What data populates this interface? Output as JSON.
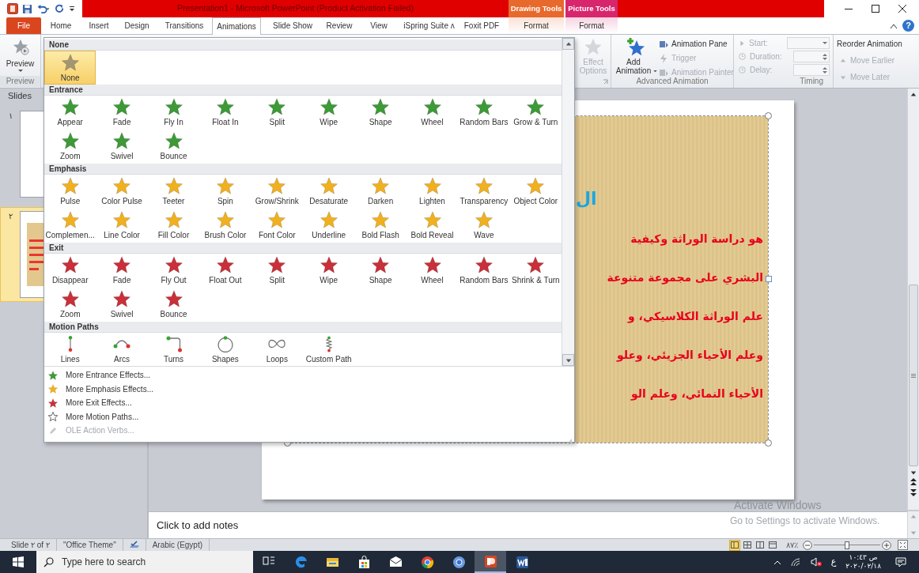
{
  "title_bar": {
    "title": "Presentation1  -  Microsoft PowerPoint (Product Activation Failed)",
    "contextual_groups": [
      {
        "label": "Drawing Tools",
        "color": "#e8692c"
      },
      {
        "label": "Picture Tools",
        "color": "#d8266e"
      }
    ]
  },
  "ribbon_tabs": [
    {
      "label": "File",
      "kind": "file",
      "selected": false
    },
    {
      "label": "Home",
      "kind": "normal",
      "selected": false
    },
    {
      "label": "Insert",
      "kind": "normal",
      "selected": false
    },
    {
      "label": "Design",
      "kind": "normal",
      "selected": false
    },
    {
      "label": "Transitions",
      "kind": "normal",
      "selected": false
    },
    {
      "label": "Animations",
      "kind": "normal",
      "selected": true
    },
    {
      "label": "Slide Show",
      "kind": "normal",
      "selected": false
    },
    {
      "label": "Review",
      "kind": "normal",
      "selected": false
    },
    {
      "label": "View",
      "kind": "normal",
      "selected": false
    },
    {
      "label": "iSpring Suite ʌ",
      "kind": "normal",
      "selected": false
    },
    {
      "label": "Foxit PDF",
      "kind": "normal",
      "selected": false
    },
    {
      "label": "Format",
      "kind": "contextual",
      "selected": false
    },
    {
      "label": "Format",
      "kind": "contextual",
      "selected": false
    }
  ],
  "help_button": "?",
  "ribbon": {
    "preview": {
      "button": "Preview",
      "group_label": "Preview"
    },
    "effect_options": {
      "label": "Effect Options",
      "disabled": true
    },
    "advanced_animation": {
      "add_animation": "Add Animation",
      "items": [
        {
          "label": "Animation Pane",
          "disabled": false
        },
        {
          "label": "Trigger",
          "disabled": true
        },
        {
          "label": "Animation Painter",
          "disabled": true
        }
      ],
      "group_label": "Advanced Animation"
    },
    "timing": {
      "fields": [
        {
          "label": "Start:",
          "kind": "dropdown"
        },
        {
          "label": "Duration:",
          "kind": "spinner"
        },
        {
          "label": "Delay:",
          "kind": "spinner"
        }
      ],
      "group_label": "Timing"
    },
    "reorder": {
      "title": "Reorder Animation",
      "items": [
        {
          "label": "Move Earlier",
          "kind": "up",
          "disabled": true
        },
        {
          "label": "Move Later",
          "kind": "down",
          "disabled": true
        }
      ]
    }
  },
  "gallery": {
    "sections": [
      {
        "title": "None",
        "kind": "none",
        "items": [
          {
            "label": "None",
            "selected": true
          }
        ]
      },
      {
        "title": "Entrance",
        "kind": "entrance",
        "items": [
          {
            "label": "Appear",
            "selected": false
          },
          {
            "label": "Fade",
            "selected": false
          },
          {
            "label": "Fly In",
            "selected": false
          },
          {
            "label": "Float In",
            "selected": false
          },
          {
            "label": "Split",
            "selected": false
          },
          {
            "label": "Wipe",
            "selected": false
          },
          {
            "label": "Shape",
            "selected": false
          },
          {
            "label": "Wheel",
            "selected": false
          },
          {
            "label": "Random Bars",
            "selected": false
          },
          {
            "label": "Grow & Turn",
            "selected": false
          },
          {
            "label": "Zoom",
            "selected": false
          },
          {
            "label": "Swivel",
            "selected": false
          },
          {
            "label": "Bounce",
            "selected": false
          }
        ]
      },
      {
        "title": "Emphasis",
        "kind": "emphasis",
        "items": [
          {
            "label": "Pulse",
            "selected": false
          },
          {
            "label": "Color Pulse",
            "selected": false
          },
          {
            "label": "Teeter",
            "selected": false
          },
          {
            "label": "Spin",
            "selected": false
          },
          {
            "label": "Grow/Shrink",
            "selected": false
          },
          {
            "label": "Desaturate",
            "selected": false
          },
          {
            "label": "Darken",
            "selected": false
          },
          {
            "label": "Lighten",
            "selected": false
          },
          {
            "label": "Transparency",
            "selected": false
          },
          {
            "label": "Object Color",
            "selected": false
          },
          {
            "label": "Complemen...",
            "selected": false
          },
          {
            "label": "Line Color",
            "selected": false
          },
          {
            "label": "Fill Color",
            "selected": false
          },
          {
            "label": "Brush Color",
            "selected": false
          },
          {
            "label": "Font Color",
            "selected": false
          },
          {
            "label": "Underline",
            "selected": false
          },
          {
            "label": "Bold Flash",
            "selected": false
          },
          {
            "label": "Bold Reveal",
            "selected": false
          },
          {
            "label": "Wave",
            "selected": false
          }
        ]
      },
      {
        "title": "Exit",
        "kind": "exit",
        "items": [
          {
            "label": "Disappear",
            "selected": false
          },
          {
            "label": "Fade",
            "selected": false
          },
          {
            "label": "Fly Out",
            "selected": false
          },
          {
            "label": "Float Out",
            "selected": false
          },
          {
            "label": "Split",
            "selected": false
          },
          {
            "label": "Wipe",
            "selected": false
          },
          {
            "label": "Shape",
            "selected": false
          },
          {
            "label": "Wheel",
            "selected": false
          },
          {
            "label": "Random Bars",
            "selected": false
          },
          {
            "label": "Shrink & Turn",
            "selected": false
          },
          {
            "label": "Zoom",
            "selected": false
          },
          {
            "label": "Swivel",
            "selected": false
          },
          {
            "label": "Bounce",
            "selected": false
          }
        ]
      },
      {
        "title": "Motion Paths",
        "kind": "motion",
        "items": [
          {
            "label": "Lines",
            "kind": "line",
            "selected": false
          },
          {
            "label": "Arcs",
            "kind": "arc",
            "selected": false
          },
          {
            "label": "Turns",
            "kind": "turn",
            "selected": false
          },
          {
            "label": "Shapes",
            "kind": "shape",
            "selected": false
          },
          {
            "label": "Loops",
            "kind": "loop",
            "selected": false
          },
          {
            "label": "Custom Path",
            "kind": "custom",
            "selected": false
          }
        ]
      }
    ],
    "menu": [
      {
        "label": "More Entrance Effects...",
        "kind": "entrance",
        "disabled": false
      },
      {
        "label": "More Emphasis Effects...",
        "kind": "emphasis",
        "disabled": false
      },
      {
        "label": "More Exit Effects...",
        "kind": "exit",
        "disabled": false
      },
      {
        "label": "More Motion Paths...",
        "kind": "motion",
        "disabled": false
      },
      {
        "label": "OLE Action Verbs...",
        "kind": "ole",
        "disabled": true
      }
    ]
  },
  "slides_panel": {
    "tab": "Slides",
    "thumbnails": [
      {
        "number": "١",
        "selected": false
      },
      {
        "number": "٢",
        "selected": true
      }
    ]
  },
  "slide": {
    "title_fragment": "ال",
    "lines": [
      "هو دراسة الوراثة وكيفية",
      "البشري على مجموعة متنوعة",
      "علم الوراثة الكلاسيكي، و",
      "وعلم الأحياء الجزيئي، وعلو",
      "الأحياء النمائي، وعلم الو"
    ]
  },
  "notes": {
    "placeholder": "Click to add notes"
  },
  "activation_notice": {
    "title": "Activate Windows",
    "text": "Go to Settings to activate Windows."
  },
  "status_bar": {
    "slide": "Slide ٢ of ٢",
    "theme": "\"Office Theme\"",
    "language": "Arabic (Egypt)",
    "views": [
      {
        "selected": true
      },
      {
        "selected": false
      },
      {
        "selected": false
      },
      {
        "selected": false
      }
    ],
    "zoom": "٨٧٪",
    "zoom_slider": {
      "level": 0.5
    }
  },
  "taskbar": {
    "search_placeholder": "Type here to search",
    "apps": [
      {
        "kind": "task_view",
        "selected": false
      },
      {
        "kind": "edge",
        "selected": false
      },
      {
        "kind": "explorer",
        "selected": false
      },
      {
        "kind": "store",
        "selected": false
      },
      {
        "kind": "mail",
        "selected": false
      },
      {
        "kind": "chrome",
        "selected": false
      },
      {
        "kind": "chrome_alt",
        "selected": false
      },
      {
        "kind": "powerpoint",
        "selected": true
      },
      {
        "kind": "word",
        "selected": false
      }
    ],
    "language": "ع",
    "time": "ص ١٠:٤٣",
    "date": "٢٠٢٠/٠٢/١٨"
  }
}
